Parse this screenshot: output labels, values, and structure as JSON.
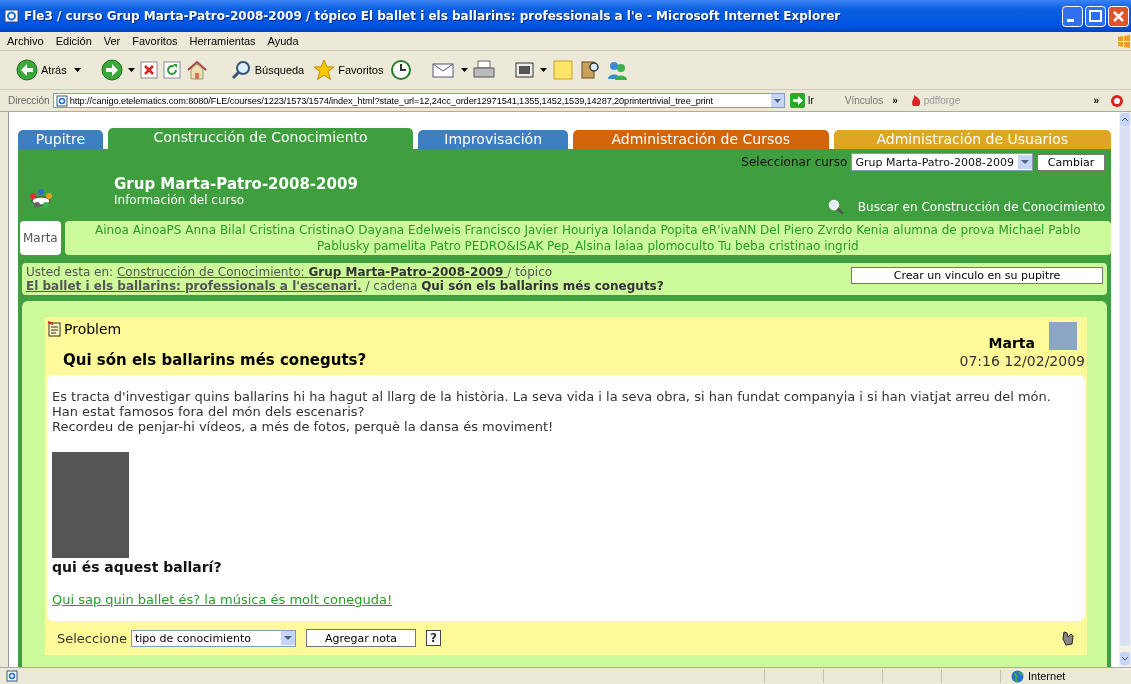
{
  "window": {
    "title": "Fle3 / curso Grup Marta-Patro-2008-2009 / tópico El ballet i els ballarins: professionals a l'e - Microsoft Internet Explorer"
  },
  "menu": [
    "Archivo",
    "Edición",
    "Ver",
    "Favoritos",
    "Herramientas",
    "Ayuda"
  ],
  "toolbar": {
    "back": "Atrás",
    "search": "Búsqueda",
    "favorites": "Favoritos"
  },
  "address_bar": {
    "label": "Dirección",
    "url": "http://canigo.etelematics.com:8080/FLE/courses/1223/1573/1574/index_html?state_url=12,24cc_order12971541,1355,1452,1539,14287,20printertrivial_tree_print",
    "go": "Ir",
    "links": "Vínculos",
    "links_more": "»",
    "pdfforge": "pdfforge",
    "toolbar_more": "»"
  },
  "tabs": [
    {
      "label": "Pupitre",
      "color": "#3d80c2",
      "selected": false
    },
    {
      "label": "Construcción de Conocimiento",
      "color": "#3f9f3f",
      "selected": true
    },
    {
      "label": "Improvisación",
      "color": "#3d80c2",
      "selected": false
    },
    {
      "label": "Administración de Cursos",
      "color": "#d2650c",
      "selected": false
    },
    {
      "label": "Administración de Usuarios",
      "color": "#e0a523",
      "selected": false
    }
  ],
  "course_selector": {
    "label": "Seleccionar curso",
    "value": "Grup Marta-Patro-2008-2009",
    "button": "Cambiar"
  },
  "course": {
    "title": "Grup Marta-Patro-2008-2009",
    "subtitle": "Información del curso",
    "search_link": "Buscar en Construcción de Conocimiento"
  },
  "members": {
    "current": "Marta",
    "names": [
      "Ainoa",
      "AinoaPS",
      "Anna",
      "Bilal",
      "Cristina",
      "CristinaO",
      "Dayana",
      "Edelweis",
      "Francisco Javier",
      "Houriya",
      "Iolanda",
      "Popita",
      "eR'ivaNN",
      "Del Piero",
      "Zvrdo",
      "Kenia",
      "alumna de prova",
      "Michael",
      "Pablo",
      "Pablusky",
      "pamelita",
      "Patro",
      "PEDRO&ISAK",
      "Pep_Alsina",
      "laiaa",
      "plomoculto",
      "Tu beba",
      "cristinao",
      "ingrid"
    ]
  },
  "breadcrumb": {
    "segments": [
      {
        "kind": "text",
        "text": "Usted esta en:"
      },
      {
        "kind": "link",
        "text": "Construcción de Conocimiento: **Grup Marta-Patro-2008-2009** "
      },
      {
        "kind": "text",
        "text": "/ tópico"
      },
      {
        "kind": "topic_link",
        "text": "El ballet i els ballarins: professionals a l'escenari."
      },
      {
        "kind": "text",
        "text": "/ cadena"
      },
      {
        "kind": "current",
        "text": "Qui són els ballarins més coneguts?"
      }
    ],
    "button": "Crear un vinculo en su pupitre"
  },
  "note": {
    "type": "Problem",
    "author": "Marta",
    "title": "Qui són els ballarins més coneguts?",
    "timestamp": "07:16 12/02/2009",
    "body": [
      "Es tracta d'investigar quins ballarins hi ha hagut al llarg de la història. La seva vida i la seva obra, si han fundat companyia i si han viatjat arreu del món. Han estat famosos fora del món dels escenaris?",
      "Recordeu de penjar-hi vídeos, a més de fotos, perquè la dansa és moviment!"
    ],
    "image_caption": "qui és aquest ballarí?",
    "link": "Qui sap quin ballet és? la música és molt coneguda!",
    "footer": {
      "label": "Seleccione",
      "select": "tipo de conocimiento",
      "button": "Agregar nota",
      "help": "?"
    }
  },
  "status_bar": {
    "zone": "Internet"
  }
}
